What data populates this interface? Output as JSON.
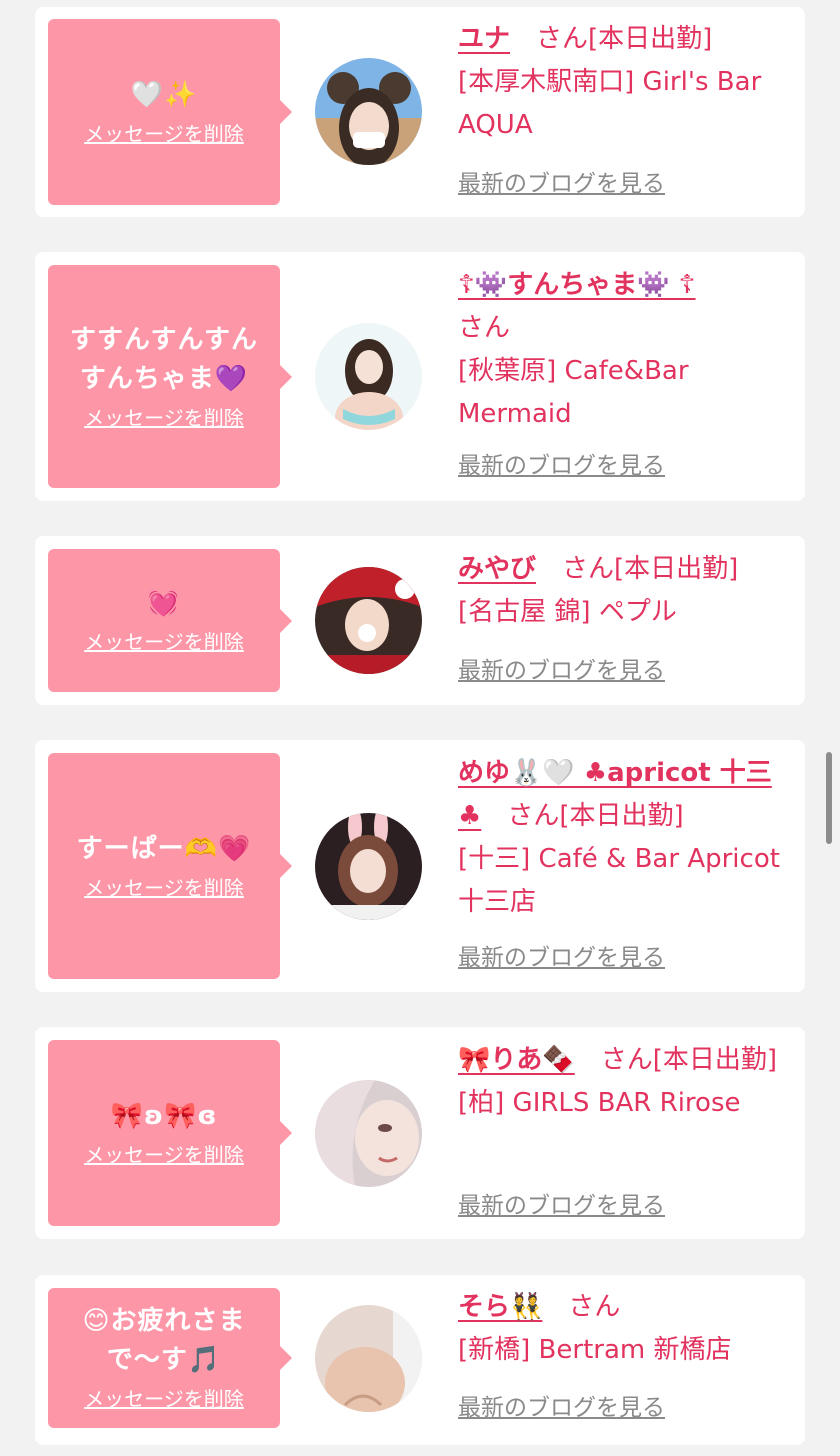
{
  "cards": [
    {
      "message": "🤍✨",
      "delete_label": "メッセージを削除",
      "name": "ユナ",
      "suffix": "　さん[本日出勤]",
      "shop": "[本厚木駅南口] Girl's Bar AQUA",
      "blog_label": "最新のブログを見る"
    },
    {
      "message": "すすんすんすんすんちゃま💜",
      "delete_label": "メッセージを削除",
      "name": "☦👾すんちゃま👾 ☦",
      "suffix": "さん",
      "shop": "[秋葉原] Cafe&Bar Mermaid",
      "blog_label": "最新のブログを見る"
    },
    {
      "message": "💓",
      "delete_label": "メッセージを削除",
      "name": "みやび",
      "suffix": "　さん[本日出勤]",
      "shop": "[名古屋 錦] ペプル",
      "blog_label": "最新のブログを見る"
    },
    {
      "message": "すーぱー🫶💗",
      "delete_label": "メッセージを削除",
      "name": "めゆ🐰🤍 ♣apricot 十三♣",
      "suffix": "　さん[本日出勤]",
      "shop": "[十三] Café & Bar Apricot 十三店",
      "blog_label": "最新のブログを見る"
    },
    {
      "message": "🎀ʚ🎀ɞ",
      "delete_label": "メッセージを削除",
      "name": "🎀りあ🍫",
      "suffix": "　さん[本日出勤]",
      "shop": "[柏] GIRLS BAR Rirose",
      "blog_label": "最新のブログを見る"
    },
    {
      "message": "😊お疲れさまで〜す🎵",
      "delete_label": "メッセージを削除",
      "name": "そら👯",
      "suffix": "　さん",
      "shop": "[新橋] Bertram 新橋店",
      "blog_label": "最新のブログを見る"
    }
  ],
  "colors": {
    "accent": "#e2335f",
    "bubble": "#fd97a8",
    "link_gray": "#8a8a8a",
    "background": "#f2f2f2"
  }
}
